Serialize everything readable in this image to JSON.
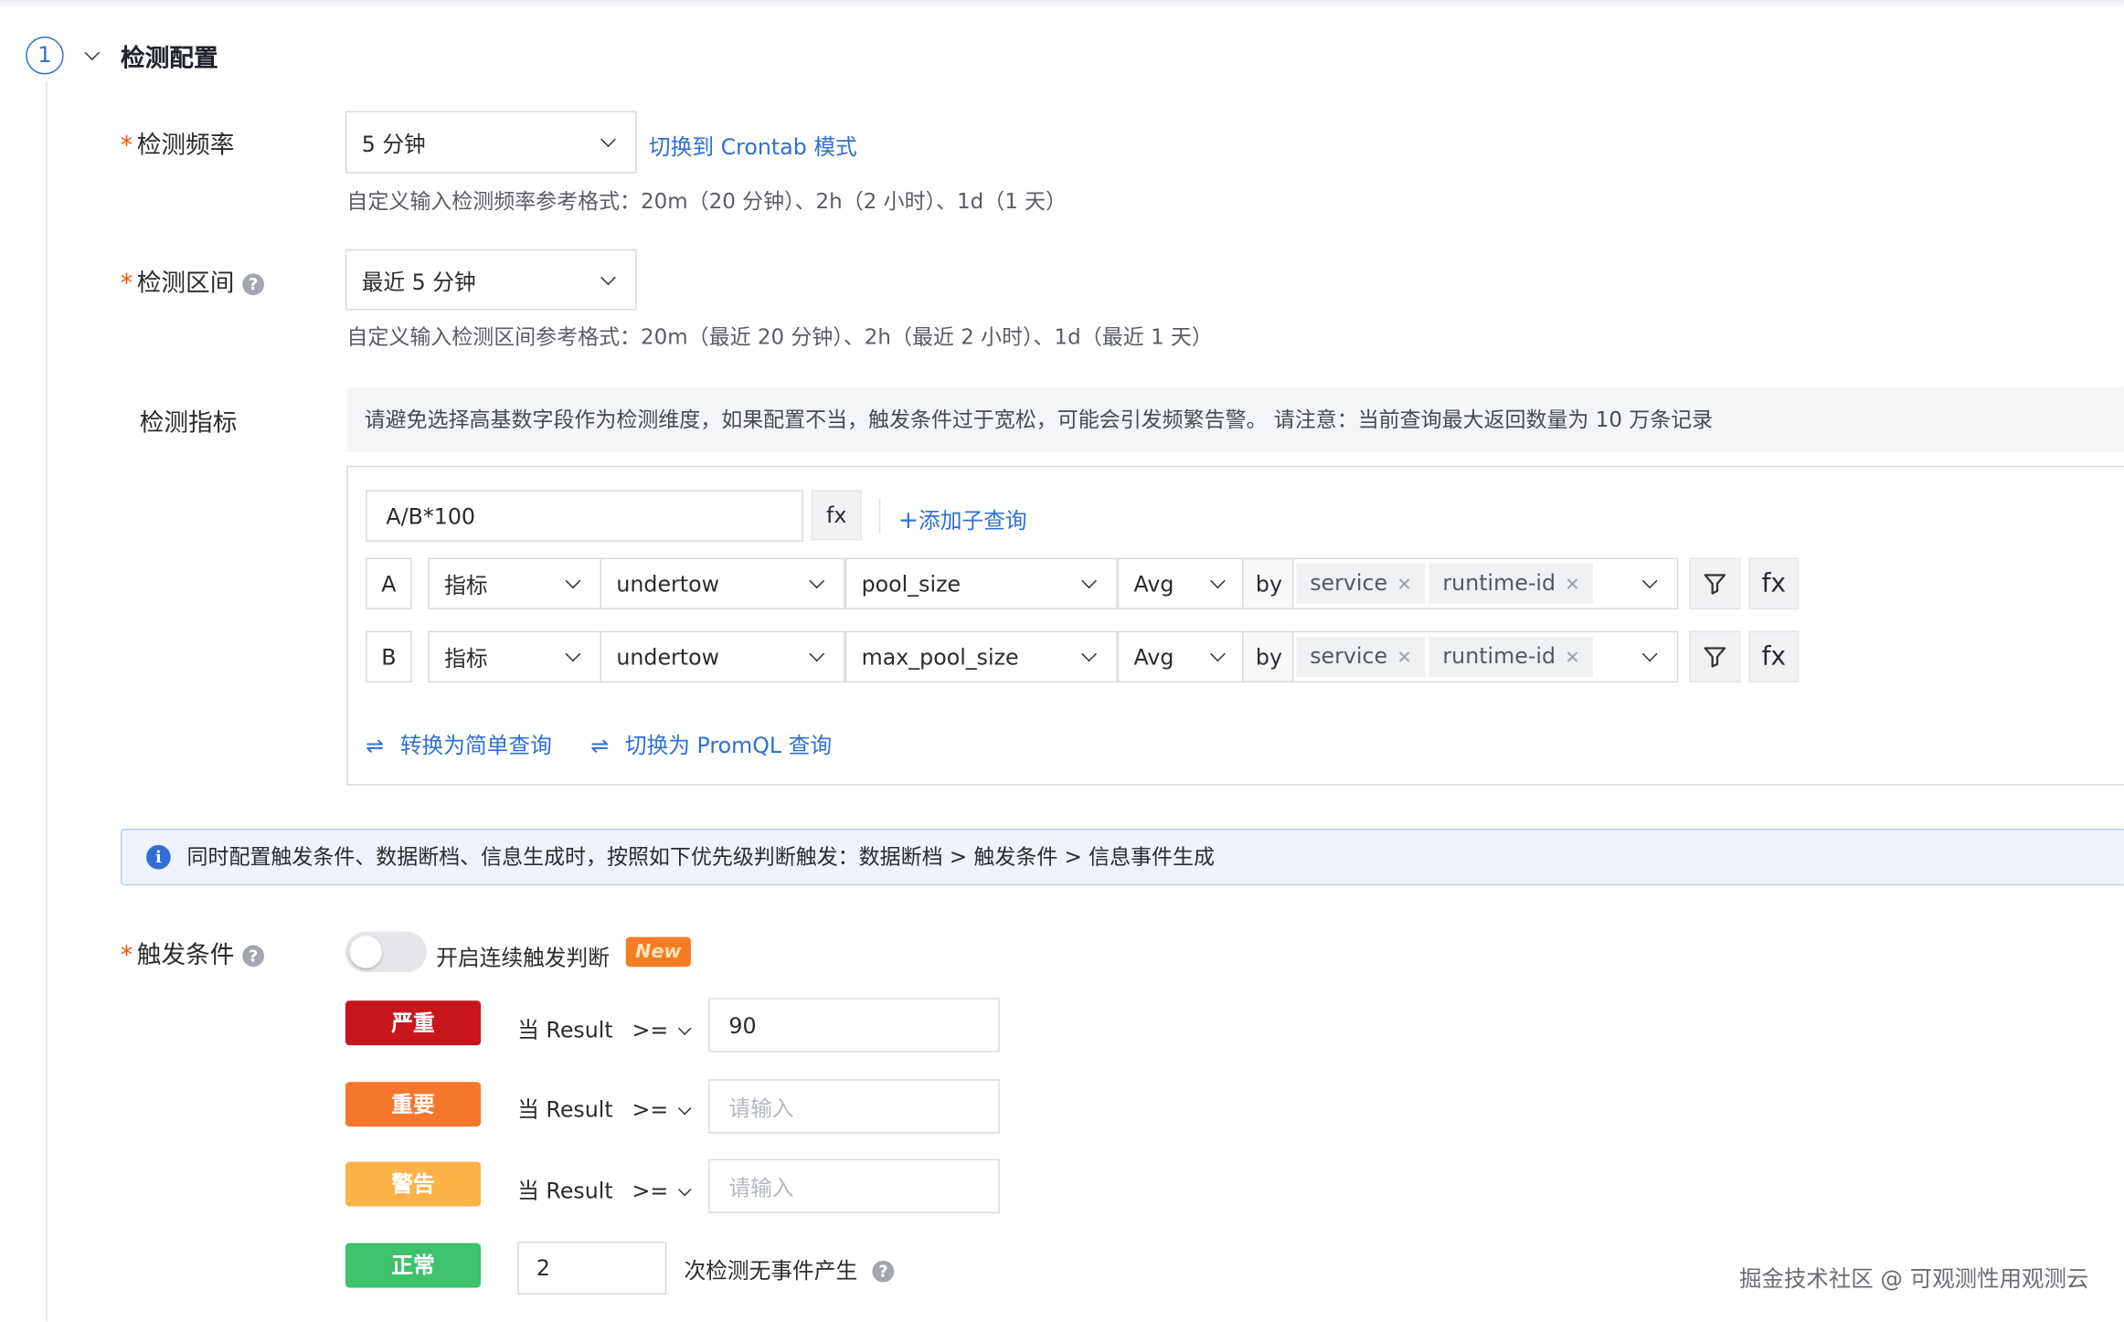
{
  "section": {
    "step": "1",
    "title": "检测配置"
  },
  "frequency": {
    "label": "检测频率",
    "value": "5 分钟",
    "switch_link": "切换到 Crontab 模式",
    "hint": "自定义输入检测频率参考格式：20m（20 分钟）、2h（2 小时）、1d（1 天）"
  },
  "interval": {
    "label": "检测区间",
    "value": "最近 5 分钟",
    "hint": "自定义输入检测区间参考格式：20m（最近 20 分钟）、2h（最近 2 小时）、1d（最近 1 天）"
  },
  "metrics": {
    "label": "检测指标",
    "notice": "请避免选择高基数字段作为检测维度，如果配置不当，触发条件过于宽松，可能会引发频繁告警。 请注意：当前查询最大返回数量为 10 万条记录",
    "expression": "A/B*100",
    "fx_label": "fx",
    "add_subquery": "添加子查询",
    "by_label": "by",
    "queries": [
      {
        "id": "A",
        "type": "指标",
        "source": "undertow",
        "metric": "pool_size",
        "agg": "Avg",
        "tags": [
          "service",
          "runtime-id"
        ]
      },
      {
        "id": "B",
        "type": "指标",
        "source": "undertow",
        "metric": "max_pool_size",
        "agg": "Avg",
        "tags": [
          "service",
          "runtime-id"
        ]
      }
    ],
    "convert_simple": "转换为简单查询",
    "switch_promql": "切换为 PromQL 查询"
  },
  "info_bar": "同时配置触发条件、数据断档、信息生成时，按照如下优先级判断触发：数据断档 > 触发条件 > 信息事件生成",
  "trigger": {
    "label": "触发条件",
    "toggle_label": "开启连续触发判断",
    "toggle_on": false,
    "new_badge": "New",
    "rules": [
      {
        "level": "严重",
        "color": "#c8161d",
        "prefix": "当 Result",
        "op": ">=",
        "value": "90",
        "placeholder": ""
      },
      {
        "level": "重要",
        "color": "#f5772c",
        "prefix": "当 Result",
        "op": ">=",
        "value": "",
        "placeholder": "请输入"
      },
      {
        "level": "警告",
        "color": "#fbb347",
        "prefix": "当 Result",
        "op": ">=",
        "value": "",
        "placeholder": "请输入"
      }
    ],
    "normal": {
      "level": "正常",
      "color": "#3ec26b",
      "count": "2",
      "suffix": "次检测无事件产生"
    }
  },
  "watermark": "掘金技术社区 @ 可观测性用观测云",
  "colors": {
    "accent": "#2f6fd3",
    "required": "#e8590c"
  }
}
